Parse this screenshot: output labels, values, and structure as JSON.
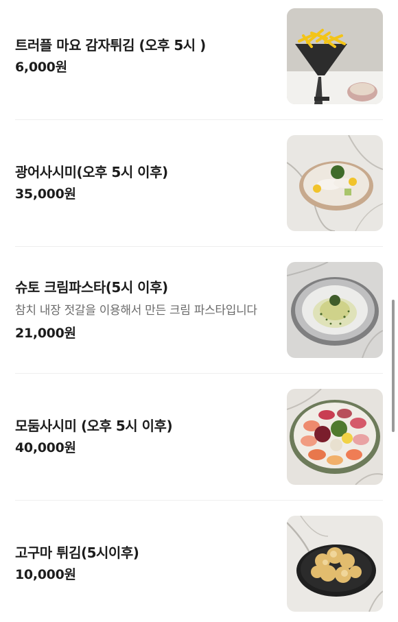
{
  "menu": {
    "items": [
      {
        "name": "트러플 마요 감자튀김 (오후 5시 )",
        "price": "6,000원",
        "image": "truffle-mayo-fries-photo"
      },
      {
        "name": "광어사시미(오후 5시 이후)",
        "price": "35,000원",
        "image": "flatfish-sashimi-photo"
      },
      {
        "name": "슈토 크림파스타(5시 이후)",
        "description": "참치 내장 젓갈을 이용해서 만든 크림 파스타입니다",
        "price": "21,000원",
        "image": "shuto-cream-pasta-photo"
      },
      {
        "name": "모둠사시미 (오후 5시 이후)",
        "price": "40,000원",
        "image": "assorted-sashimi-photo"
      },
      {
        "name": "고구마 튀김(5시이후)",
        "price": "10,000원",
        "image": "sweet-potato-tempura-photo"
      }
    ]
  }
}
